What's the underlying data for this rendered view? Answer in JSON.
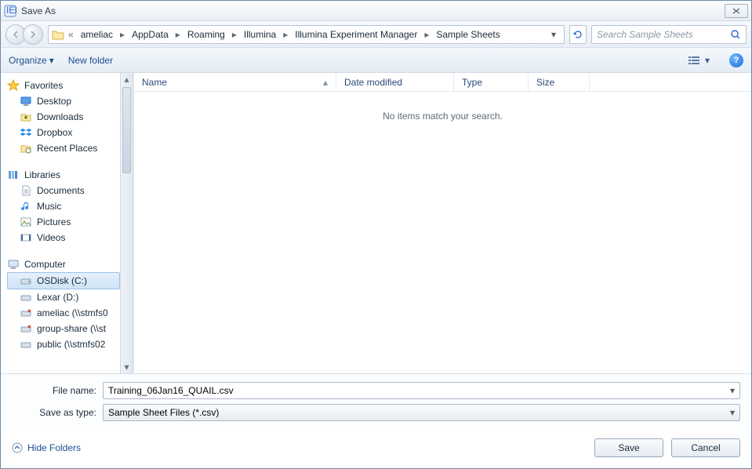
{
  "window": {
    "title": "Save As"
  },
  "breadcrumbs": {
    "overflow": "«",
    "items": [
      "ameliac",
      "AppData",
      "Roaming",
      "Illumina",
      "Illumina Experiment Manager",
      "Sample Sheets"
    ]
  },
  "search": {
    "placeholder": "Search Sample Sheets"
  },
  "toolbar": {
    "organize": "Organize",
    "newfolder": "New folder"
  },
  "tree": {
    "favorites": {
      "label": "Favorites",
      "items": [
        "Desktop",
        "Downloads",
        "Dropbox",
        "Recent Places"
      ]
    },
    "libraries": {
      "label": "Libraries",
      "items": [
        "Documents",
        "Music",
        "Pictures",
        "Videos"
      ]
    },
    "computer": {
      "label": "Computer",
      "items": [
        "OSDisk (C:)",
        "Lexar (D:)",
        "ameliac (\\\\stmfs0",
        "group-share (\\\\st",
        "public (\\\\stmfs02"
      ]
    }
  },
  "columns": {
    "name": "Name",
    "date": "Date modified",
    "type": "Type",
    "size": "Size"
  },
  "listing": {
    "empty": "No items match your search."
  },
  "form": {
    "filename_label": "File name:",
    "filename_value": "Training_06Jan16_QUAIL.csv",
    "savetype_label": "Save as type:",
    "savetype_value": "Sample Sheet Files (*.csv)"
  },
  "footer": {
    "hide": "Hide Folders",
    "save": "Save",
    "cancel": "Cancel"
  }
}
